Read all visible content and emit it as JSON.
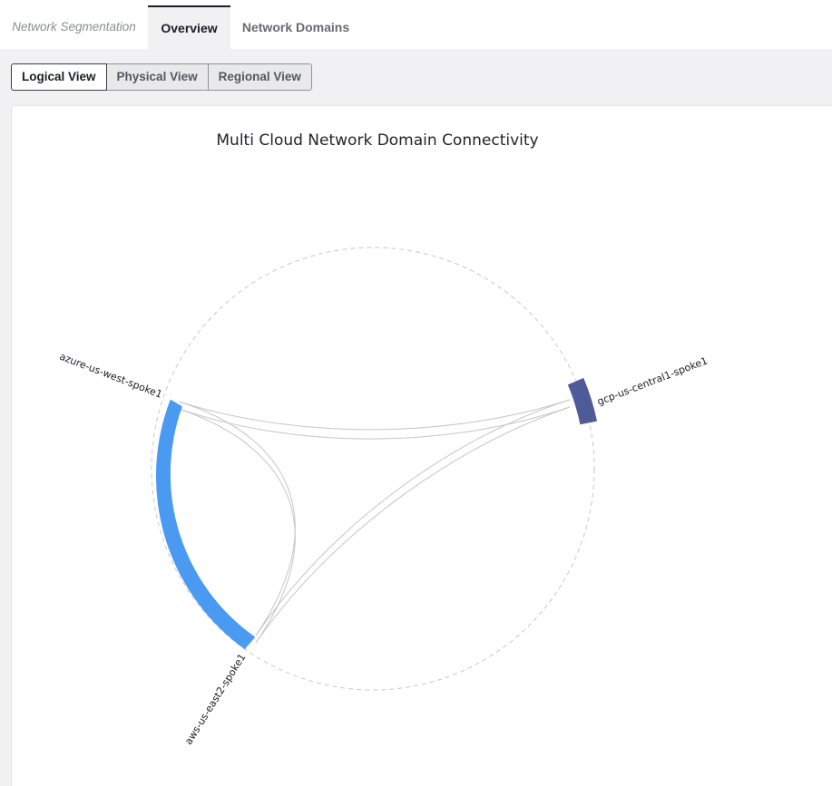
{
  "tabs": {
    "section_label": "Network Segmentation",
    "overview": "Overview",
    "network_domains": "Network Domains"
  },
  "views": {
    "logical": "Logical View",
    "physical": "Physical View",
    "regional": "Regional View"
  },
  "colors": {
    "azure": "#4a9af2",
    "aws": "#4a9af2",
    "gcp": "#4f5a98",
    "ribbon": "#c6c6ca",
    "guide": "#c9c9cd"
  },
  "chart_data": {
    "type": "chord",
    "title": "Multi Cloud Network Domain Connectivity",
    "nodes": [
      {
        "name": "azure-us-west-spoke1",
        "color": "#4a9af2"
      },
      {
        "name": "gcp-us-central1-spoke1",
        "color": "#4f5a98"
      },
      {
        "name": "aws-us-east2-spoke1",
        "color": "#4a9af2"
      }
    ],
    "links": [
      {
        "source": "azure-us-west-spoke1",
        "target": "gcp-us-central1-spoke1"
      },
      {
        "source": "azure-us-west-spoke1",
        "target": "aws-us-east2-spoke1"
      },
      {
        "source": "aws-us-east2-spoke1",
        "target": "gcp-us-central1-spoke1"
      }
    ]
  }
}
